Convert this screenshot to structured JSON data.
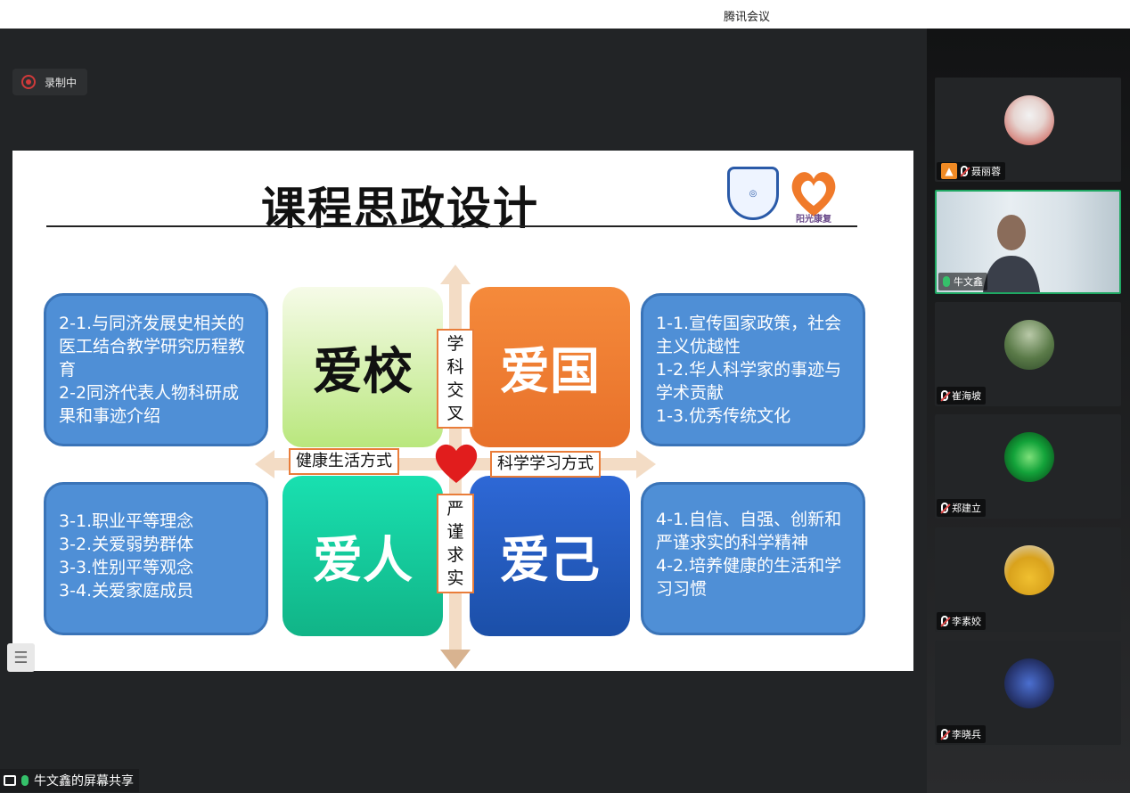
{
  "app": {
    "title": "腾讯会议"
  },
  "recording": {
    "label": "录制中"
  },
  "slide": {
    "title": "课程思政设计",
    "logo2_text": "阳光康复",
    "quadrants": {
      "school": "爱校",
      "country": "爱国",
      "people": "爱人",
      "self": "爱己"
    },
    "vertical_labels": {
      "top": [
        "学",
        "科",
        "交",
        "叉"
      ],
      "bottom": [
        "严",
        "谨",
        "求",
        "实"
      ]
    },
    "horizontal_labels": {
      "left": "健康生活方式",
      "right": "科学学习方式"
    },
    "boxes": {
      "top_left": [
        "2-1.与同济发展史相关的医工结合教学研究历程教育",
        "2-2同济代表人物科研成果和事迹介绍"
      ],
      "top_right": [
        "1-1.宣传国家政策，社会主义优越性",
        "1-2.华人科学家的事迹与学术贡献",
        "1-3.优秀传统文化"
      ],
      "bottom_left": [
        "3-1.职业平等理念",
        "3-2.关爱弱势群体",
        "3-3.性别平等观念",
        "3-4.关爱家庭成员"
      ],
      "bottom_right": [
        "4-1.自信、自强、创新和严谨求实的科学精神",
        "4-2.培养健康的生活和学习习惯"
      ]
    }
  },
  "share_bar": {
    "label": "牛文鑫的屏幕共享"
  },
  "participants": [
    {
      "name": "聂丽蓉",
      "mic": "off",
      "host": true,
      "avatar_color": "#c9493f"
    },
    {
      "name": "牛文鑫",
      "mic": "on",
      "video": true
    },
    {
      "name": "崔海坡",
      "mic": "off",
      "avatar_color": "#3f6b3a"
    },
    {
      "name": "郑建立",
      "mic": "off",
      "avatar_color": "#0f7a2a"
    },
    {
      "name": "李素姣",
      "mic": "off",
      "avatar_color": "#d9a21c"
    },
    {
      "name": "李晓兵",
      "mic": "off",
      "avatar_color": "#2a3a78"
    }
  ]
}
